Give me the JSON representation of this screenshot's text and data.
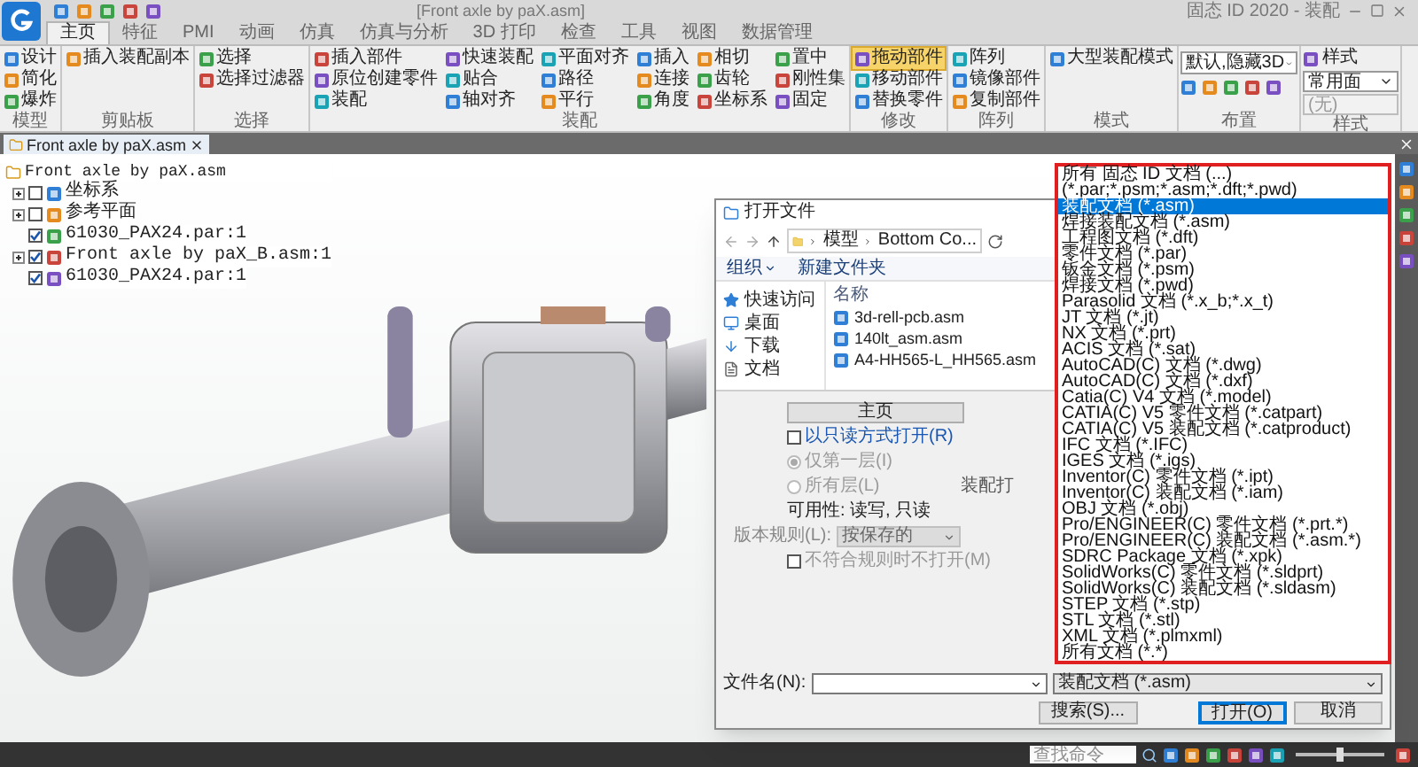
{
  "title_bar": {
    "document": "[Front axle by paX.asm]",
    "app": "固态 ID 2020 - 装配"
  },
  "ribbon_tabs": [
    {
      "label": "主页",
      "selected": true
    },
    {
      "label": "特征",
      "selected": false
    },
    {
      "label": "PMI",
      "selected": false
    },
    {
      "label": "动画",
      "selected": false
    },
    {
      "label": "仿真",
      "selected": false
    },
    {
      "label": "仿真与分析",
      "selected": false
    },
    {
      "label": "3D 打印",
      "selected": false
    },
    {
      "label": "检查",
      "selected": false
    },
    {
      "label": "工具",
      "selected": false
    },
    {
      "label": "视图",
      "selected": false
    },
    {
      "label": "数据管理",
      "selected": false
    }
  ],
  "ribbon_groups": [
    {
      "label": "模型",
      "columns": [
        {
          "kind": "stack",
          "items": [
            {
              "label": "设计",
              "active": false
            },
            {
              "label": "简化",
              "active": false
            },
            {
              "label": "爆炸",
              "active": false
            }
          ]
        }
      ]
    },
    {
      "label": "剪贴板",
      "columns": [
        {
          "kind": "stack",
          "items": [
            {
              "label": "插入装配副本",
              "active": false
            }
          ]
        }
      ]
    },
    {
      "label": "选择",
      "columns": [
        {
          "kind": "stack",
          "items": [
            {
              "label": "选择",
              "active": false
            },
            {
              "label": "选择过滤器",
              "active": false
            }
          ]
        }
      ]
    },
    {
      "label": "装配",
      "columns": [
        {
          "kind": "stack",
          "items": [
            {
              "label": "插入部件",
              "active": false
            },
            {
              "label": "原位创建零件",
              "active": false
            },
            {
              "label": "装配",
              "active": false
            }
          ]
        },
        {
          "kind": "stack",
          "items": [
            {
              "label": "快速装配",
              "active": false
            },
            {
              "label": "贴合",
              "active": false
            },
            {
              "label": "轴对齐",
              "active": false
            }
          ]
        },
        {
          "kind": "stack",
          "items": [
            {
              "label": "平面对齐",
              "active": false
            },
            {
              "label": "路径",
              "active": false
            },
            {
              "label": "平行",
              "active": false
            }
          ]
        },
        {
          "kind": "stack",
          "items": [
            {
              "label": "插入",
              "active": false
            },
            {
              "label": "连接",
              "active": false
            },
            {
              "label": "角度",
              "active": false
            }
          ]
        },
        {
          "kind": "stack",
          "items": [
            {
              "label": "相切",
              "active": false
            },
            {
              "label": "齿轮",
              "active": false
            },
            {
              "label": "坐标系",
              "active": false
            }
          ]
        },
        {
          "kind": "stack",
          "items": [
            {
              "label": "置中",
              "active": false
            },
            {
              "label": "刚性集",
              "active": false
            },
            {
              "label": "固定",
              "active": false
            }
          ]
        }
      ]
    },
    {
      "label": "修改",
      "columns": [
        {
          "kind": "stack",
          "items": [
            {
              "label": "拖动部件",
              "active": true
            },
            {
              "label": "移动部件",
              "active": false
            },
            {
              "label": "替换零件",
              "active": false
            }
          ]
        }
      ]
    },
    {
      "label": "阵列",
      "columns": [
        {
          "kind": "stack",
          "items": [
            {
              "label": "阵列",
              "active": false
            },
            {
              "label": "镜像部件",
              "active": false
            },
            {
              "label": "复制部件",
              "active": false
            }
          ]
        }
      ]
    },
    {
      "label": "模式",
      "columns": [
        {
          "kind": "stack",
          "items": [
            {
              "label": "大型装配模式",
              "active": false
            }
          ]
        }
      ]
    },
    {
      "label": "布置",
      "columns": [
        {
          "kind": "combo",
          "value": "默认,隐藏3D"
        }
      ]
    },
    {
      "label": "样式",
      "columns": [
        {
          "kind": "style",
          "label": "样式",
          "value": "常用面",
          "field": "(无)"
        }
      ]
    }
  ],
  "document_tab": {
    "label": "Front axle by paX.asm"
  },
  "tree": [
    {
      "label": "Front axle by paX.asm",
      "children": [
        {
          "label": "坐标系",
          "checked": false,
          "expandable": true
        },
        {
          "label": "参考平面",
          "checked": false,
          "expandable": true
        },
        {
          "label": "61030_PAX24.par:1",
          "checked": true,
          "expandable": false
        },
        {
          "label": "Front axle by paX_B.asm:1",
          "checked": true,
          "expandable": true
        },
        {
          "label": "61030_PAX24.par:1",
          "checked": true,
          "expandable": false
        }
      ]
    }
  ],
  "dialog": {
    "title": "打开文件",
    "breadcrumb": [
      "模型",
      "Bottom Co..."
    ],
    "organize": "组织",
    "new_folder": "新建文件夹",
    "nav": [
      {
        "label": "快速访问",
        "kind": "star"
      },
      {
        "label": "桌面",
        "kind": "desktop"
      },
      {
        "label": "下载",
        "kind": "download"
      },
      {
        "label": "文档",
        "kind": "document"
      }
    ],
    "column": "名称",
    "files": [
      "3d-rell-pcb.asm",
      "140lt_asm.asm",
      "A4-HH565-L_HH565.asm"
    ],
    "home_button": "主页",
    "readonly": {
      "label": "以只读方式打开(R)",
      "checked": false
    },
    "levels": {
      "disabled": true,
      "options": [
        {
          "label": "仅第一层(I)",
          "selected": true
        },
        {
          "label": "所有层(L)",
          "selected": false
        }
      ]
    },
    "side_label": "装配打",
    "availability": "可用性: 读写, 只读",
    "version_rule": {
      "label": "版本规则(L):",
      "value": "按保存的"
    },
    "no_open": {
      "label": "不符合规则时不打开(M)",
      "checked": false
    },
    "filename_label": "文件名(N):",
    "filetype": "装配文档 (*.asm)",
    "buttons": [
      "搜索(S)...",
      "打开(O)",
      "取消"
    ],
    "filetype_list": [
      {
        "label": "所有 固态 ID 文档 (...) (*.par;*.psm;*.asm;*.dft;*.pwd)",
        "selected": false
      },
      {
        "label": "装配文档 (*.asm)",
        "selected": true
      },
      {
        "label": "焊接装配文档 (*.asm)",
        "selected": false
      },
      {
        "label": "工程图文档 (*.dft)",
        "selected": false
      },
      {
        "label": "零件文档 (*.par)",
        "selected": false
      },
      {
        "label": "钣金文档 (*.psm)",
        "selected": false
      },
      {
        "label": "焊接文档 (*.pwd)",
        "selected": false
      },
      {
        "label": "Parasolid 文档 (*.x_b;*.x_t)",
        "selected": false
      },
      {
        "label": "JT 文档 (*.jt)",
        "selected": false
      },
      {
        "label": "NX 文档 (*.prt)",
        "selected": false
      },
      {
        "label": "ACIS 文档 (*.sat)",
        "selected": false
      },
      {
        "label": "AutoCAD(C) 文档 (*.dwg)",
        "selected": false
      },
      {
        "label": "AutoCAD(C) 文档 (*.dxf)",
        "selected": false
      },
      {
        "label": "Catia(C) V4 文档 (*.model)",
        "selected": false
      },
      {
        "label": "CATIA(C) V5 零件文档 (*.catpart)",
        "selected": false
      },
      {
        "label": "CATIA(C) V5 装配文档 (*.catproduct)",
        "selected": false
      },
      {
        "label": "IFC 文档 (*.IFC)",
        "selected": false
      },
      {
        "label": "IGES 文档 (*.igs)",
        "selected": false
      },
      {
        "label": "Inventor(C) 零件文档 (*.ipt)",
        "selected": false
      },
      {
        "label": "Inventor(C) 装配文档 (*.iam)",
        "selected": false
      },
      {
        "label": "OBJ 文档 (*.obj)",
        "selected": false
      },
      {
        "label": "Pro/ENGINEER(C) 零件文档 (*.prt.*)",
        "selected": false
      },
      {
        "label": "Pro/ENGINEER(C) 装配文档 (*.asm.*)",
        "selected": false
      },
      {
        "label": "SDRC Package 文档 (*.xpk)",
        "selected": false
      },
      {
        "label": "SolidWorks(C) 零件文档 (*.sldprt)",
        "selected": false
      },
      {
        "label": "SolidWorks(C) 装配文档 (*.sldasm)",
        "selected": false
      },
      {
        "label": "STEP 文档 (*.stp)",
        "selected": false
      },
      {
        "label": "STL 文档 (*.stl)",
        "selected": false
      },
      {
        "label": "XML 文档 (*.plmxml)",
        "selected": false
      },
      {
        "label": "所有文档 (*.*)",
        "selected": false
      }
    ]
  },
  "status_bar": {
    "search_placeholder": "查找命令",
    "zoom_slider": {
      "level": 0.5
    }
  }
}
